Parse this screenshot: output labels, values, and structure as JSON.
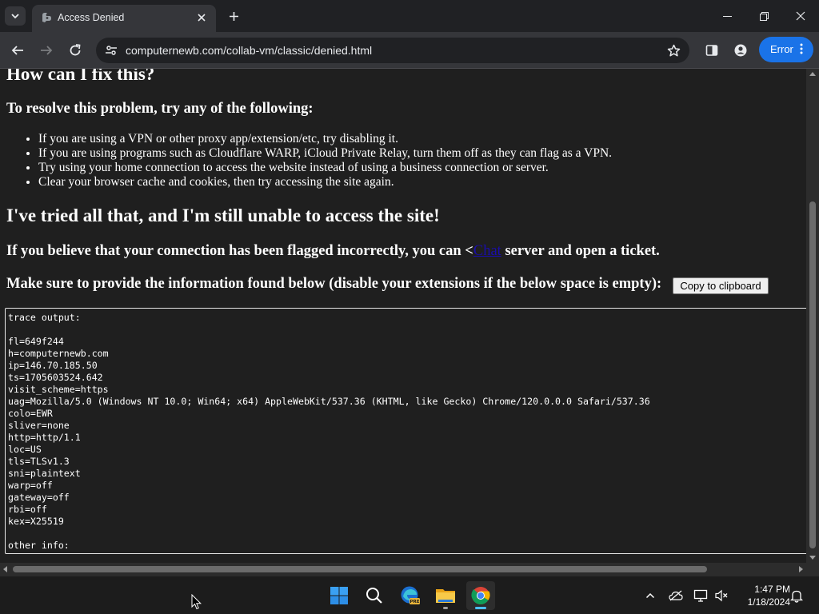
{
  "browser": {
    "tab": {
      "title": "Access Denied"
    },
    "address_bar": {
      "url": "computernewb.com/collab-vm/classic/denied.html"
    },
    "profile_button": {
      "label": "Error"
    },
    "colors": {
      "accent": "#1a73e8",
      "frame": "#202124",
      "toolbar": "#35363a"
    }
  },
  "page": {
    "heading_fix": "How can I fix this?",
    "heading_resolve": "To resolve this problem, try any of the following:",
    "suggestions": [
      "If you are using a VPN or other proxy app/extension/etc, try disabling it.",
      "If you are using programs such as Cloudflare WARP, iCloud Private Relay, turn them off as they can flag as a VPN.",
      "Try using your home connection to access the website instead of using a business connection or server.",
      "Clear your browser cache and cookies, then try accessing the site again."
    ],
    "heading_tried": "I've tried all that, and I'm still unable to access the site!",
    "flagged_text_before": "If you believe that your connection has been flagged incorrectly, you can <",
    "flagged_link": "Chat",
    "flagged_text_after": " server and open a ticket.",
    "provide_text": "Make sure to provide the information found below (disable your extensions if the below space is empty):",
    "copy_button": "Copy to clipboard",
    "trace_lines": [
      "trace output:",
      "",
      "fl=649f244",
      "h=computernewb.com",
      "ip=146.70.185.50",
      "ts=1705603524.642",
      "visit_scheme=https",
      "uag=Mozilla/5.0 (Windows NT 10.0; Win64; x64) AppleWebKit/537.36 (KHTML, like Gecko) Chrome/120.0.0.0 Safari/537.36",
      "colo=EWR",
      "sliver=none",
      "http=http/1.1",
      "loc=US",
      "tls=TLSv1.3",
      "sni=plaintext",
      "warp=off",
      "gateway=off",
      "rbi=off",
      "kex=X25519",
      "",
      "other info:"
    ]
  },
  "taskbar": {
    "apps": [
      "start-icon",
      "search-icon",
      "edge-beta-icon",
      "file-explorer-icon",
      "chrome-icon"
    ],
    "tray": [
      "chevron-up-icon",
      "onedrive-icon",
      "network-icon",
      "volume-muted-icon",
      "notification-bell-icon"
    ],
    "time": "1:47 PM",
    "date": "1/18/2024"
  }
}
